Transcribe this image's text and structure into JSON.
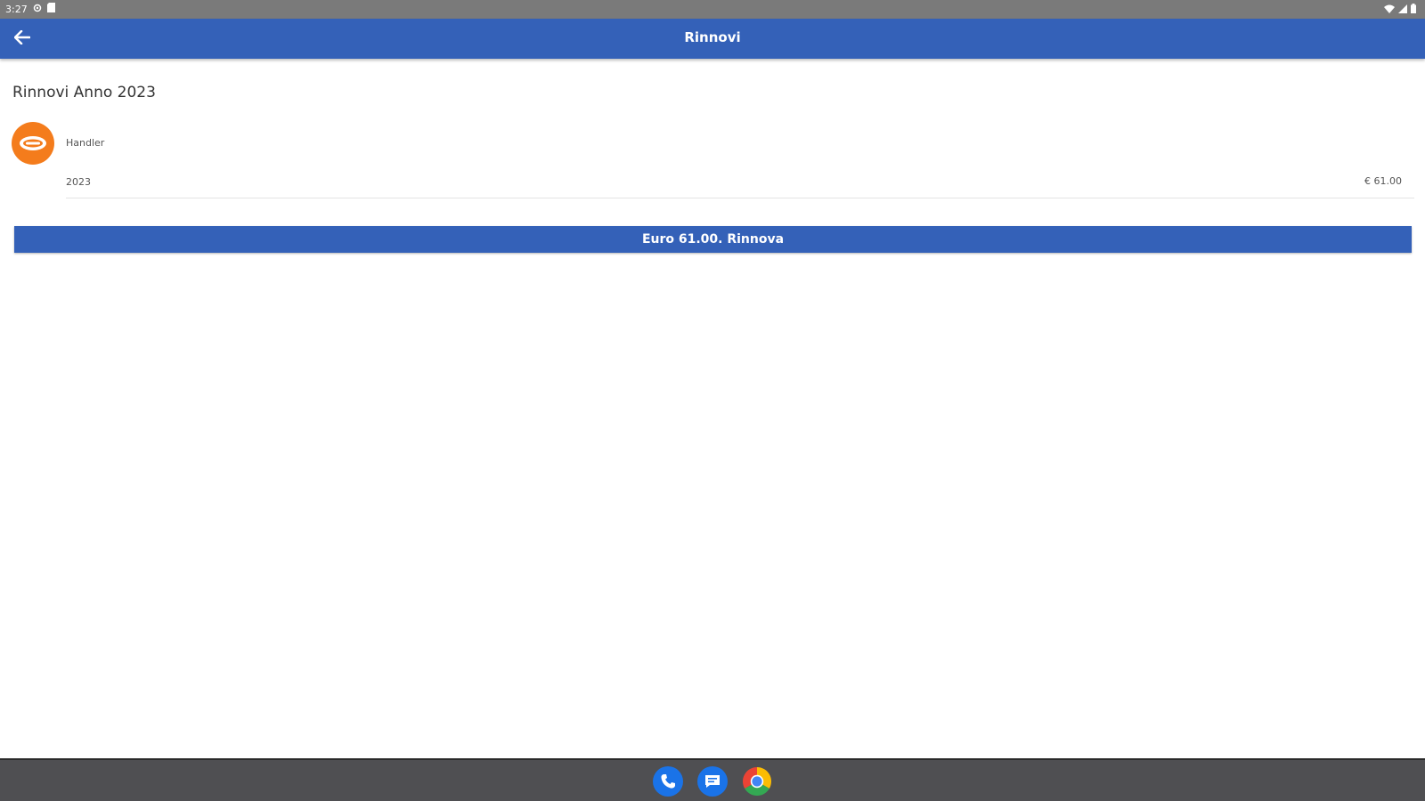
{
  "status_bar": {
    "time": "3:27",
    "icons": [
      "settings-icon",
      "sd-card-icon",
      "wifi-icon",
      "signal-icon",
      "battery-icon"
    ]
  },
  "app_bar": {
    "title": "Rinnovi",
    "back_icon": "arrow-back-icon",
    "color": "#3461b8"
  },
  "section": {
    "title": "Rinnovi Anno 2023"
  },
  "renewal_item": {
    "name": "Handler",
    "year": "2023",
    "price": "€ 61.00",
    "logo_color": "#f47c1c"
  },
  "renew_button": {
    "label": "Euro 61.00. Rinnova"
  },
  "dock": {
    "apps": [
      "phone-icon",
      "messages-icon",
      "chrome-icon"
    ]
  }
}
